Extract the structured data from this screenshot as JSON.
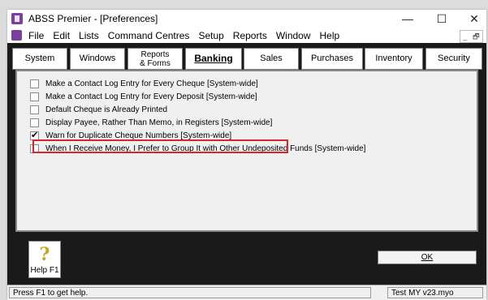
{
  "window": {
    "title": "ABSS Premier - [Preferences]"
  },
  "controls": {
    "minimize": "—",
    "maximize": "☐",
    "close": "✕",
    "mdi_min": "_",
    "mdi_restore": "🗗"
  },
  "menu": [
    "File",
    "Edit",
    "Lists",
    "Command Centres",
    "Setup",
    "Reports",
    "Window",
    "Help"
  ],
  "tabs": [
    {
      "label": "System"
    },
    {
      "label": "Windows"
    },
    {
      "label": "Reports & Forms"
    },
    {
      "label": "Banking",
      "active": true
    },
    {
      "label": "Sales"
    },
    {
      "label": "Purchases"
    },
    {
      "label": "Inventory"
    },
    {
      "label": "Security"
    }
  ],
  "options": [
    {
      "label": "Make a Contact Log Entry for Every Cheque [System-wide]",
      "checked": false
    },
    {
      "label": "Make a Contact Log Entry for Every Deposit [System-wide]",
      "checked": false
    },
    {
      "label": "Default Cheque is Already Printed",
      "checked": false
    },
    {
      "label": "Display Payee, Rather Than Memo, in Registers [System-wide]",
      "checked": false,
      "highlighted": true
    },
    {
      "label": "Warn for Duplicate Cheque Numbers [System-wide]",
      "checked": true
    },
    {
      "label": "When I Receive Money, I Prefer to Group It with Other Undeposited Funds [System-wide]",
      "checked": false
    }
  ],
  "help_button": {
    "icon": "question-mark-icon",
    "label": "Help F1"
  },
  "ok_button": {
    "label": "OK"
  },
  "status": {
    "left": "Press F1 to get help.",
    "right": "Test MY v23.myo"
  },
  "colors": {
    "highlight": "#d9262b",
    "client_bg": "#1a1a1a",
    "app_icon": "#7b3fa0"
  }
}
